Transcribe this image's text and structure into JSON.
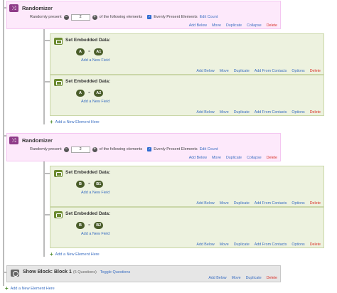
{
  "randomizers": [
    {
      "title": "Randomizer",
      "present_prefix": "Randomly present",
      "count_value": "2",
      "present_suffix": "of the following elements",
      "evenly_label": "Evenly Present Elements",
      "edit_count": "Edit Count",
      "actions": [
        "Add Below",
        "Move",
        "Duplicate",
        "Collapse",
        "Delete"
      ],
      "elements": [
        {
          "title": "Set Embedded Data:",
          "field": "A",
          "op": "=",
          "value": "A1",
          "add_field": "Add a New Field",
          "actions": [
            "Add Below",
            "Move",
            "Duplicate",
            "Add From Contacts",
            "Options",
            "Delete"
          ]
        },
        {
          "title": "Set Embedded Data:",
          "field": "A",
          "op": "=",
          "value": "A2",
          "add_field": "Add a New Field",
          "actions": [
            "Add Below",
            "Move",
            "Duplicate",
            "Add From Contacts",
            "Options",
            "Delete"
          ]
        }
      ],
      "add_element": "Add a New Element Here"
    },
    {
      "title": "Randomizer",
      "present_prefix": "Randomly present",
      "count_value": "2",
      "present_suffix": "of the following elements",
      "evenly_label": "Evenly Present Elements",
      "edit_count": "Edit Count",
      "actions": [
        "Add Below",
        "Move",
        "Duplicate",
        "Collapse",
        "Delete"
      ],
      "elements": [
        {
          "title": "Set Embedded Data:",
          "field": "B",
          "op": "=",
          "value": "B1",
          "add_field": "Add a New Field",
          "actions": [
            "Add Below",
            "Move",
            "Duplicate",
            "Add From Contacts",
            "Options",
            "Delete"
          ]
        },
        {
          "title": "Set Embedded Data:",
          "field": "B",
          "op": "=",
          "value": "B2",
          "add_field": "Add a New Field",
          "actions": [
            "Add Below",
            "Move",
            "Duplicate",
            "Add From Contacts",
            "Options",
            "Delete"
          ]
        }
      ],
      "add_element": "Add a New Element Here"
    }
  ],
  "show_block": {
    "title": "Show Block: Block 1",
    "sub": "(6 Questions)",
    "toggle": "Toggle Questions",
    "actions": [
      "Add Below",
      "Move",
      "Duplicate",
      "Delete"
    ]
  },
  "bottom_add_element": "Add a New Element Here",
  "colors": {
    "randomizer_bg": "#fde9fb",
    "randomizer_icon": "#8e3b88",
    "embedded_bg": "#edf2df",
    "pill": "#4a5d2a",
    "link": "#3a6ec2",
    "delete": "#d9342b"
  },
  "icons": {
    "randomizer": "shuffle-icon",
    "embedded_data": "embedded-data-icon",
    "show_block": "block-icon",
    "minus": "minus-circle-icon",
    "plus": "plus-circle-icon",
    "checkbox": "checkbox-checked-icon",
    "add": "plus-icon"
  }
}
